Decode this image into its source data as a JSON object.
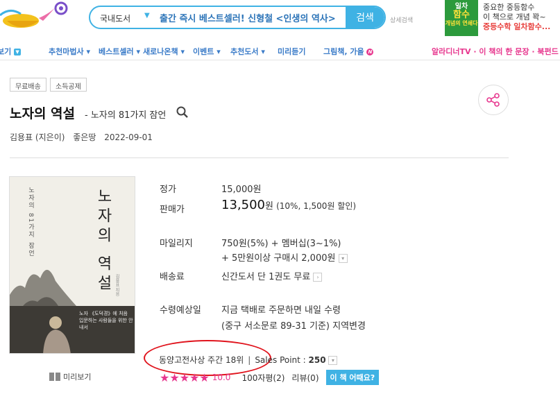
{
  "header": {
    "search_category": "국내도서",
    "search_query": "출간 즉시 베스트셀러! 신형철 <인생의 역사>",
    "search_button": "검색",
    "detail_search": "상세검색",
    "ad": {
      "book_lines": [
        "일차",
        "함수",
        "개념의 연쇄다"
      ],
      "line1": "중요한 중등함수",
      "line2": "이 책으로 개념 꽉~",
      "line3": "중등수학 일차함수..."
    }
  },
  "nav": {
    "items": [
      "보기",
      "추천마법사",
      "베스트셀러",
      "새로나온책",
      "이벤트",
      "추천도서",
      "미리듣기",
      "그림책, 가을"
    ],
    "badge": "N",
    "right": "알라디너TV · 이 책의 한 문장 · 북펀드"
  },
  "tags": [
    "무료배송",
    "소득공제"
  ],
  "book": {
    "title": "노자의 역설",
    "subtitle": "- 노자의 81가지 잠언",
    "author": "김용표 (지은이)",
    "publisher": "좋은땅",
    "date": "2022-09-01"
  },
  "cover": {
    "vertical_title": "노자의 역설",
    "small_sub": "노자의 81가지 잠언",
    "author_v": "김용표 지음",
    "band_text": "노자 《도덕경》에 처음 입문하는 사람들을 위한 안내서"
  },
  "preview_label": "미리보기",
  "info": {
    "list_price_label": "정가",
    "list_price": "15,000원",
    "sale_price_label": "판매가",
    "sale_price": "13,500",
    "sale_unit": "원",
    "sale_note": "(10%, 1,500원 할인)",
    "mileage_label": "마일리지",
    "mileage_line1": "750원(5%) + 멤버십(3~1%)",
    "mileage_line2": "+ 5만원이상 구매시 2,000원",
    "shipping_label": "배송료",
    "shipping_value": "신간도서 단 1권도 무료",
    "delivery_label": "수령예상일",
    "delivery_line1": "지금 택배로 주문하면 내일 수령",
    "delivery_line2": "(중구 서소문로 89-31 기준) 지역변경"
  },
  "rank": {
    "text": "동양고전사상 주간 18위",
    "sales_label": "Sales Point :",
    "sales_value": "250"
  },
  "rating": {
    "stars": "★★★★★",
    "score": "10.0",
    "reviews_100": "100자평(2)",
    "reviews": "리뷰(0)",
    "button": "이 책 어때요?"
  },
  "colors": {
    "accent_blue": "#3fb2e4",
    "nav_blue": "#3a7bc8",
    "pink": "#e7378e",
    "annotation_red": "#e0141d"
  }
}
